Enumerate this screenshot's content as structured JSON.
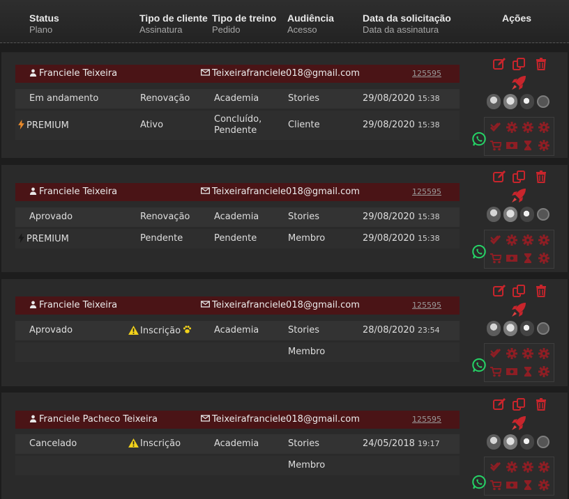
{
  "header": {
    "col1": {
      "top": "Status",
      "sub": "Plano"
    },
    "col2": {
      "top": "Tipo de cliente",
      "sub": "Assinatura"
    },
    "col3": {
      "top": "Tipo de treino",
      "sub": "Pedido"
    },
    "col4": {
      "top": "Audiência",
      "sub": "Acesso"
    },
    "col5": {
      "top": "Data da solicitação",
      "sub": "Data da assinatura"
    },
    "col6": {
      "top": "Ações"
    }
  },
  "records": [
    {
      "name": "Franciele Teixeira",
      "email": "Teixeirafranciele018@gmail.com",
      "id": "125595",
      "row1": {
        "status": "Em andamento",
        "client_type": "Renovação",
        "training": "Academia",
        "audience": "Stories",
        "date": "29/08/2020",
        "time": "15:38"
      },
      "row2": {
        "plan": "PREMIUM",
        "subscription": "Ativo",
        "order": "Concluído, Pendente",
        "access": "Cliente",
        "date": "29/08/2020",
        "time": "15:38"
      }
    },
    {
      "name": "Franciele Teixeira",
      "email": "Teixeirafranciele018@gmail.com",
      "id": "125595",
      "row1": {
        "status": "Aprovado",
        "client_type": "Renovação",
        "training": "Academia",
        "audience": "Stories",
        "date": "29/08/2020",
        "time": "15:38"
      },
      "row2": {
        "plan": "PREMIUM",
        "subscription": "Pendente",
        "order": "Pendente",
        "access": "Membro",
        "date": "29/08/2020",
        "time": "15:38"
      }
    },
    {
      "name": "Franciele Teixeira",
      "email": "Teixeirafranciele018@gmail.com",
      "id": "125595",
      "row1": {
        "status": "Aprovado",
        "client_type": "Inscrição",
        "training": "Academia",
        "audience": "Stories",
        "date": "28/08/2020",
        "time": "23:54"
      },
      "row2": {
        "access": "Membro"
      }
    },
    {
      "name": "Franciele Pacheco Teixeira",
      "email": "Teixeirafranciele018@gmail.com",
      "id": "125595",
      "row1": {
        "status": "Cancelado",
        "client_type": "Inscrição",
        "training": "Academia",
        "audience": "Stories",
        "date": "24/05/2018",
        "time": "19:17"
      },
      "row2": {
        "access": "Membro"
      }
    }
  ],
  "icons": {
    "edit": "edit-icon",
    "copy": "copy-icon",
    "delete": "trash-icon",
    "rocket": "rocket-icon",
    "whatsapp": "whatsapp-icon",
    "lightning": "lightning-icon",
    "warning": "warning-icon",
    "paw": "paw-icon"
  },
  "colors": {
    "accent_red": "#c8252c",
    "dim_red": "#8e1e24",
    "namebar": "#4a1416",
    "lightning_orange": "#e8892a",
    "warning_yellow": "#f2d21b",
    "whatsapp_green": "#25d366"
  }
}
